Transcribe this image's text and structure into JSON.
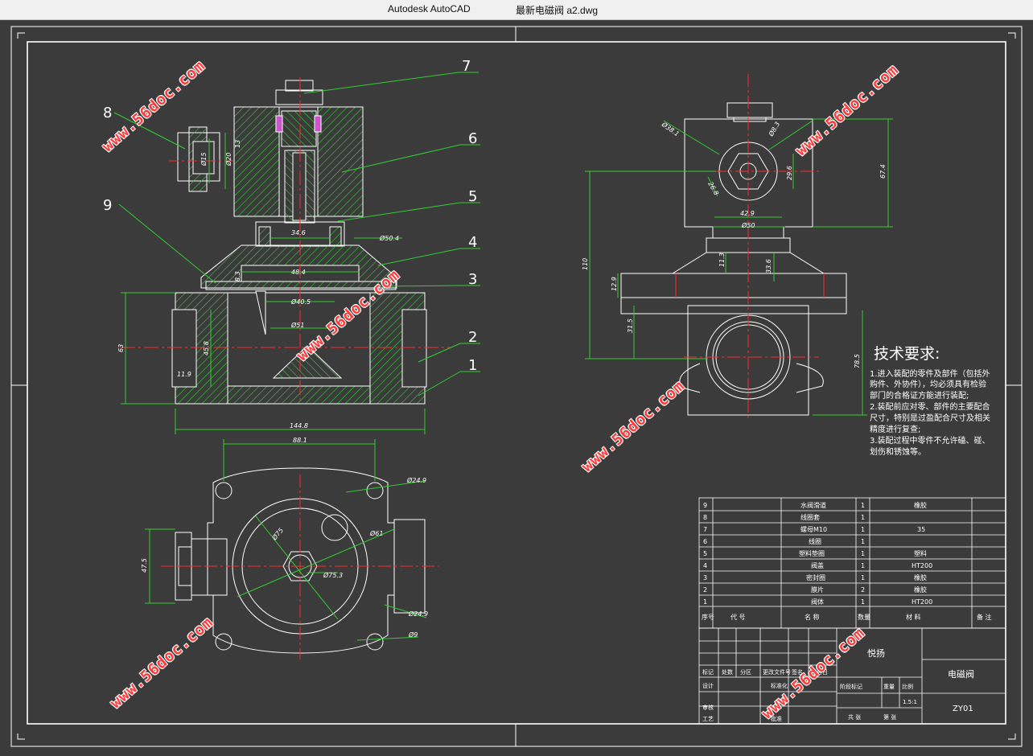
{
  "window": {
    "app_name": "Autodesk AutoCAD",
    "document_name": "最新电磁阀 a2.dwg"
  },
  "colors": {
    "background": "#3b3b3b",
    "lines": "#ffffff",
    "hatch": "#33cc33",
    "dimension": "#33cc33",
    "center": "#ff2a2a",
    "leader": "#33cc33",
    "watermark": "#ff3a3a"
  },
  "watermark": {
    "text": "www.56doc.com"
  },
  "balloons": [
    "1",
    "2",
    "3",
    "4",
    "5",
    "6",
    "7",
    "8",
    "9"
  ],
  "dims_front": {
    "d_o346": "34.6",
    "d_o504": "Ø50.4",
    "d_484": "48.4",
    "d_83": "8.3",
    "d_o405": "Ø40.5",
    "d_o51": "Ø51",
    "d_63": "63",
    "d_458": "45.8",
    "d_119": "11.9",
    "d_1448": "144.8",
    "d_o15": "Ø15",
    "d_o20": "Ø20",
    "d_13": "13"
  },
  "dims_plan": {
    "d_881": "88.1",
    "d_o249": "Ø24.9",
    "d_o75": "Ø75",
    "d_o61": "Ø61",
    "d_o753": "Ø75.3",
    "d_475": "47.5",
    "d_o249b": "Ø24.9",
    "d_o9": "Ø9"
  },
  "dims_side": {
    "d_o381": "Ø38.1",
    "d_o83": "Ø8.3",
    "d_268": "26.8",
    "d_296": "29.6",
    "d_674": "67.4",
    "d_429": "42.9",
    "d_o50": "Ø50",
    "d_110": "110",
    "d_113": "11.3",
    "d_336": "33.6",
    "d_129": "12.9",
    "d_315": "31.5",
    "d_785": "78.5"
  },
  "tech_requirements": {
    "title": "技术要求:",
    "lines": [
      "1.进入装配的零件及部件（包括外",
      "购件、外协件），均必须具有检验",
      "部门的合格证方能进行装配;",
      "2.装配前应对零、部件的主要配合",
      "尺寸，特别是过盈配合尺寸及相关",
      "精度进行复查;",
      "3.装配过程中零件不允许磕、碰、",
      "划伤和锈蚀等。"
    ]
  },
  "bom": {
    "rows": [
      {
        "no": "9",
        "name": "水阀滑道",
        "qty": "1",
        "material": "橡胶"
      },
      {
        "no": "8",
        "name": "线圈套",
        "qty": "1",
        "material": ""
      },
      {
        "no": "7",
        "name": "螺母M10",
        "qty": "1",
        "material": "35"
      },
      {
        "no": "6",
        "name": "线圈",
        "qty": "1",
        "material": ""
      },
      {
        "no": "5",
        "name": "塑料垫圈",
        "qty": "1",
        "material": "塑料"
      },
      {
        "no": "4",
        "name": "阀盖",
        "qty": "1",
        "material": "HT200"
      },
      {
        "no": "3",
        "name": "密封圈",
        "qty": "1",
        "material": "橡胶"
      },
      {
        "no": "2",
        "name": "膜片",
        "qty": "2",
        "material": "橡胶"
      },
      {
        "no": "1",
        "name": "阀体",
        "qty": "1",
        "material": "HT200"
      }
    ],
    "header": {
      "no": "序号",
      "code": "代 号",
      "name": "名 称",
      "qty": "数量",
      "material": "材 料",
      "remark": "备 注"
    }
  },
  "title_block": {
    "company": "悦扬",
    "drawing_name": "电磁阀",
    "drawing_no": "ZY01",
    "scale": "1.5:1",
    "labels": {
      "mark": "标记",
      "count": "处数",
      "zone": "分区",
      "doc": "更改文件号",
      "sign": "签名",
      "date": "年月日",
      "design": "设计",
      "check": "审核",
      "process": "工艺",
      "std": "标准化",
      "approve": "批准",
      "stage": "阶段标记",
      "weight": "重量",
      "ratio": "比例",
      "total": "共  张",
      "sheet": "第  张"
    }
  }
}
